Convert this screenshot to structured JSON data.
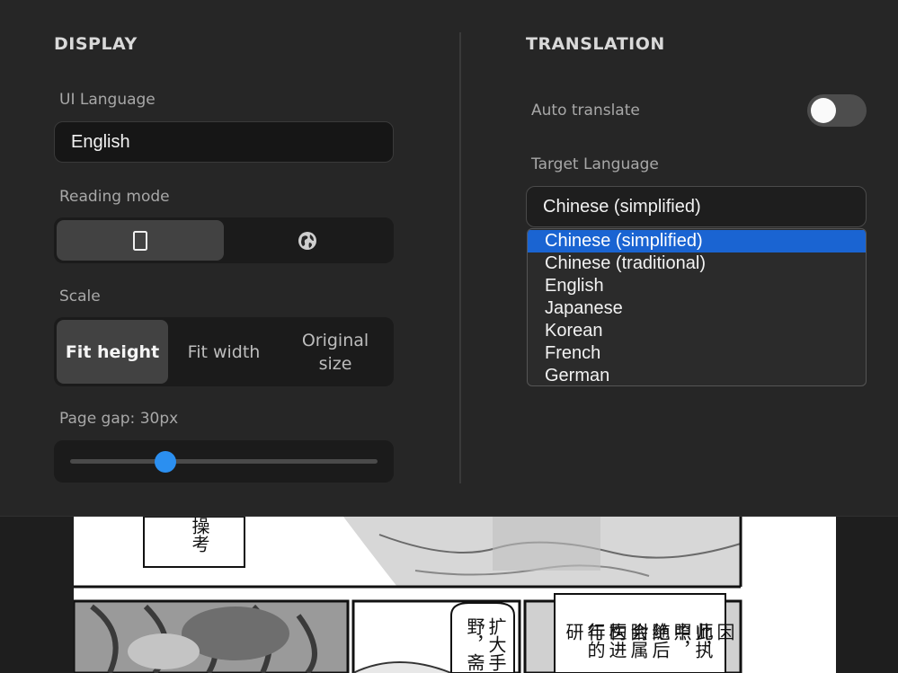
{
  "display": {
    "title": "DISPLAY",
    "ui_language_label": "UI Language",
    "ui_language_value": "English",
    "reading_mode_label": "Reading mode",
    "reading_mode_options": [
      {
        "icon": "single-page-icon",
        "selected": true
      },
      {
        "icon": "globe-icon",
        "selected": false
      }
    ],
    "scale_label": "Scale",
    "scale_options": [
      "Fit height",
      "Fit width",
      "Original size"
    ],
    "scale_selected": "Fit height",
    "page_gap_label": "Page gap: 30px",
    "page_gap_fraction": 0.31
  },
  "translation": {
    "title": "TRANSLATION",
    "auto_translate_label": "Auto translate",
    "auto_translate_on": false,
    "target_language_label": "Target Language",
    "target_language_value": "Chinese (simplified)",
    "language_options": [
      "Chinese (simplified)",
      "Chinese (traditional)",
      "English",
      "Japanese",
      "Korean",
      "French",
      "German"
    ]
  },
  "manga": {
    "bubble_top": [
      "操考"
    ],
    "bubble_middle": [
      "扩大手",
      "野，斋"
    ],
    "bubble_right": [
      "因此，",
      "师执照",
      "中，绝",
      "随后会",
      "附属医",
      "构进行",
      "年的研"
    ]
  },
  "colors": {
    "accent": "#2b8ff0",
    "selected_option": "#1a64d2",
    "panel_bg": "#262626"
  }
}
